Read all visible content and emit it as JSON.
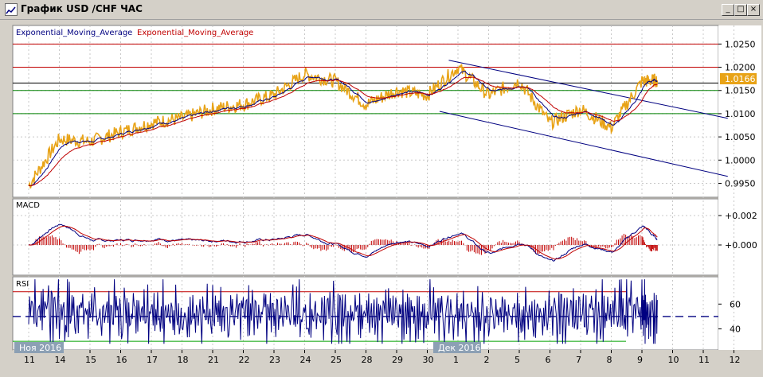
{
  "window": {
    "title": "График USD /CHF ЧАС",
    "buttons": {
      "minimize": "_",
      "maximize": "□",
      "close": "×"
    }
  },
  "legend": {
    "ema_blue": "Exponential_Moving_Average",
    "ema_red": "Exponential_Moving_Average"
  },
  "indicators": {
    "macd_label": "MACD",
    "rsi_label": "RSI"
  },
  "colors": {
    "price": "#e8a317",
    "ema_fast": "#000080",
    "ema_slow": "#c00000",
    "channel": "#000080",
    "current_price_bg": "#e8a317"
  },
  "chart_data": [
    {
      "type": "line",
      "title": "",
      "y_ticks": [
        1.025,
        1.02,
        1.015,
        1.01,
        1.005,
        1.0,
        0.995
      ],
      "y_tick_labels": [
        "1.0250",
        "1.0200",
        "1.0150",
        "1.0100",
        "1.0050",
        "1.0000",
        "0.9950"
      ],
      "ylim": [
        0.992,
        1.029
      ],
      "current_price": 1.0166,
      "current_price_label": "1.0166",
      "x_tick_labels": [
        "11",
        "14",
        "15",
        "16",
        "17",
        "18",
        "21",
        "22",
        "23",
        "24",
        "25",
        "28",
        "29",
        "30",
        "1",
        "2",
        "5",
        "6",
        "7",
        "8",
        "9",
        "10",
        "11",
        "12"
      ],
      "x_period_labels": [
        "Ноя 2016",
        "Дек 2016"
      ],
      "horizontal_lines": [
        {
          "value": 1.025,
          "color": "#c00000"
        },
        {
          "value": 1.02,
          "color": "#c00000"
        },
        {
          "value": 1.0166,
          "color": "#000000"
        },
        {
          "value": 1.015,
          "color": "#008000"
        },
        {
          "value": 1.01,
          "color": "#008000"
        }
      ],
      "series_keys": [
        {
          "name": "Exponential_Moving_Average",
          "color": "#000080"
        },
        {
          "name": "Exponential_Moving_Average",
          "color": "#c00000"
        }
      ],
      "price_path_x_index": [
        0,
        1,
        2,
        3,
        4,
        5,
        6,
        7,
        8,
        9,
        10,
        11,
        12,
        13,
        14,
        15,
        16,
        17,
        18,
        19,
        20,
        20.5
      ],
      "price_path": [
        0.9945,
        1.0045,
        1.004,
        1.006,
        1.008,
        1.009,
        1.011,
        1.012,
        1.014,
        1.0185,
        1.017,
        1.012,
        1.015,
        1.014,
        1.02,
        1.014,
        1.017,
        1.008,
        1.011,
        1.007,
        1.017,
        1.0172
      ],
      "channel_upper": [
        [
          13.7,
          1.0215
        ],
        [
          22.8,
          1.009
        ]
      ],
      "channel_lower": [
        [
          13.4,
          1.0105
        ],
        [
          22.8,
          0.9965
        ]
      ]
    },
    {
      "type": "line",
      "title": "MACD",
      "y_tick_labels": [
        "+0.002",
        "+0.000"
      ],
      "y_ticks": [
        0.002,
        0.0
      ]
    },
    {
      "type": "line",
      "title": "RSI",
      "y_tick_labels": [
        "60",
        "40"
      ],
      "y_ticks": [
        60,
        40
      ],
      "levels": [
        70,
        50,
        30
      ]
    }
  ]
}
